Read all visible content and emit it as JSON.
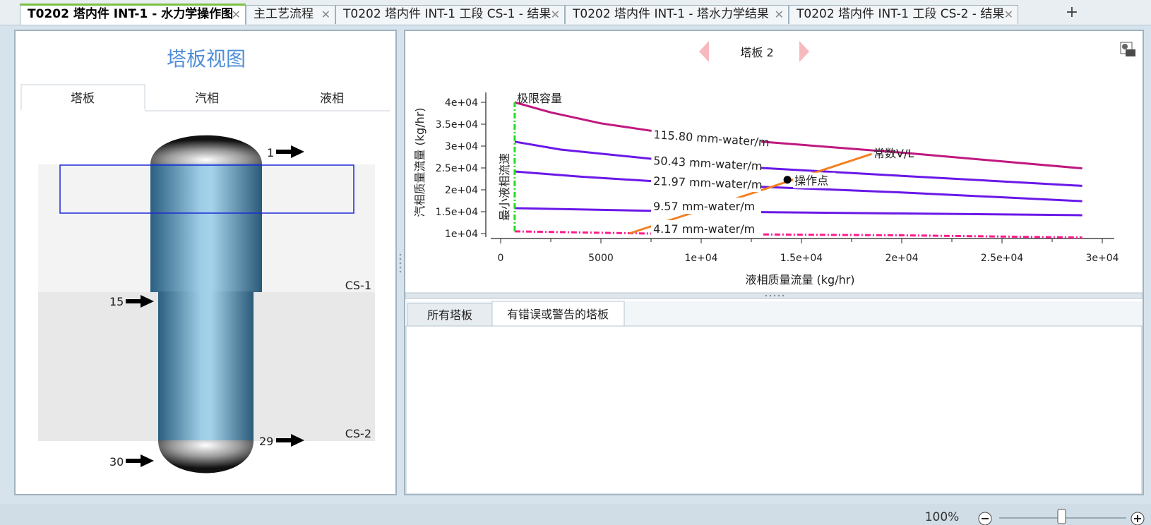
{
  "tabs": [
    {
      "label": "T0202 塔内件 INT-1 - 水力学操作图",
      "active": true
    },
    {
      "label": "主工艺流程",
      "active": false
    },
    {
      "label": "T0202 塔内件 INT-1 工段 CS-1 - 结果",
      "active": false
    },
    {
      "label": "T0202 塔内件 INT-1 - 塔水力学结果",
      "active": false
    },
    {
      "label": "T0202 塔内件 INT-1 工段 CS-2 - 结果",
      "active": false
    }
  ],
  "close_glyph": "✕",
  "new_tab_glyph": "+",
  "left_panel": {
    "title": "塔板视图",
    "tabs": [
      "塔板",
      "汽相",
      "液相"
    ],
    "stream_labels": {
      "s1": "1",
      "s15": "15",
      "s29": "29",
      "s30": "30"
    },
    "section_labels": {
      "cs1": "CS-1",
      "cs2": "CS-2"
    }
  },
  "right_panel": {
    "nav_label": "塔板 2",
    "bottom_tabs": [
      "所有塔板",
      "有错误或警告的塔板"
    ]
  },
  "chart_data": {
    "type": "line",
    "xlabel": "液相质量流量 (kg/hr)",
    "ylabel": "汽相质量流量 (kg/hr)",
    "xlim": [
      0,
      30000
    ],
    "ylim": [
      10000,
      40000
    ],
    "x_ticks": [
      0,
      5000,
      10000,
      15000,
      20000,
      25000,
      30000
    ],
    "x_tick_labels": [
      "0",
      "5000",
      "1e+04",
      "1.5e+04",
      "2e+04",
      "2.5e+04",
      "3e+04"
    ],
    "y_ticks": [
      10000,
      15000,
      20000,
      25000,
      30000,
      35000,
      40000
    ],
    "y_tick_labels": [
      "1e+04",
      "1.5e+04",
      "2e+04",
      "2.5e+04",
      "3e+04",
      "3.5e+04",
      "4e+04"
    ],
    "series": [
      {
        "name": "115.80 mm-water/m",
        "color": "#c0187f",
        "style": "solid",
        "points": [
          [
            700,
            40000
          ],
          [
            2500,
            37700
          ],
          [
            5000,
            35200
          ],
          [
            7500,
            33500
          ],
          [
            13000,
            31000
          ],
          [
            20000,
            28500
          ],
          [
            29000,
            24900
          ]
        ]
      },
      {
        "name": "50.43 mm-water/m",
        "color": "#6a18e8",
        "style": "solid",
        "points": [
          [
            700,
            31000
          ],
          [
            3000,
            29200
          ],
          [
            7500,
            27100
          ],
          [
            13000,
            25000
          ],
          [
            20000,
            23200
          ],
          [
            29000,
            20900
          ]
        ]
      },
      {
        "name": "21.97 mm-water/m",
        "color": "#6a18e8",
        "style": "solid",
        "points": [
          [
            700,
            24200
          ],
          [
            4000,
            23000
          ],
          [
            7500,
            22000
          ],
          [
            13000,
            20700
          ],
          [
            20000,
            19400
          ],
          [
            29000,
            17400
          ]
        ]
      },
      {
        "name": "9.57 mm-water/m",
        "color": "#6a18e8",
        "style": "solid",
        "points": [
          [
            700,
            15800
          ],
          [
            7500,
            15200
          ],
          [
            13000,
            14900
          ],
          [
            20000,
            14600
          ],
          [
            29000,
            14200
          ]
        ]
      },
      {
        "name": "4.17 mm-water/m",
        "color": "#ff1a8c",
        "style": "dashdot",
        "points": [
          [
            700,
            10500
          ],
          [
            7500,
            10000
          ],
          [
            13000,
            9800
          ],
          [
            20000,
            9600
          ],
          [
            29000,
            9100
          ]
        ]
      },
      {
        "name": "常数V/L",
        "color": "#f28022",
        "style": "solid",
        "points": [
          [
            6400,
            10000
          ],
          [
            18500,
            28200
          ]
        ]
      },
      {
        "name": "最小液相流速",
        "color": "#22dd22",
        "style": "dashdot",
        "points": [
          [
            700,
            10500
          ],
          [
            700,
            40000
          ]
        ]
      }
    ],
    "labels": {
      "limit": "极限容量",
      "min_liquid": "最小液相流速",
      "constant_vl": "常数V/L",
      "operating_point": "操作点"
    },
    "operating_point": [
      14300,
      22300
    ]
  },
  "status": {
    "zoom": "100%",
    "zoom_minus": "−",
    "zoom_plus": "+"
  }
}
